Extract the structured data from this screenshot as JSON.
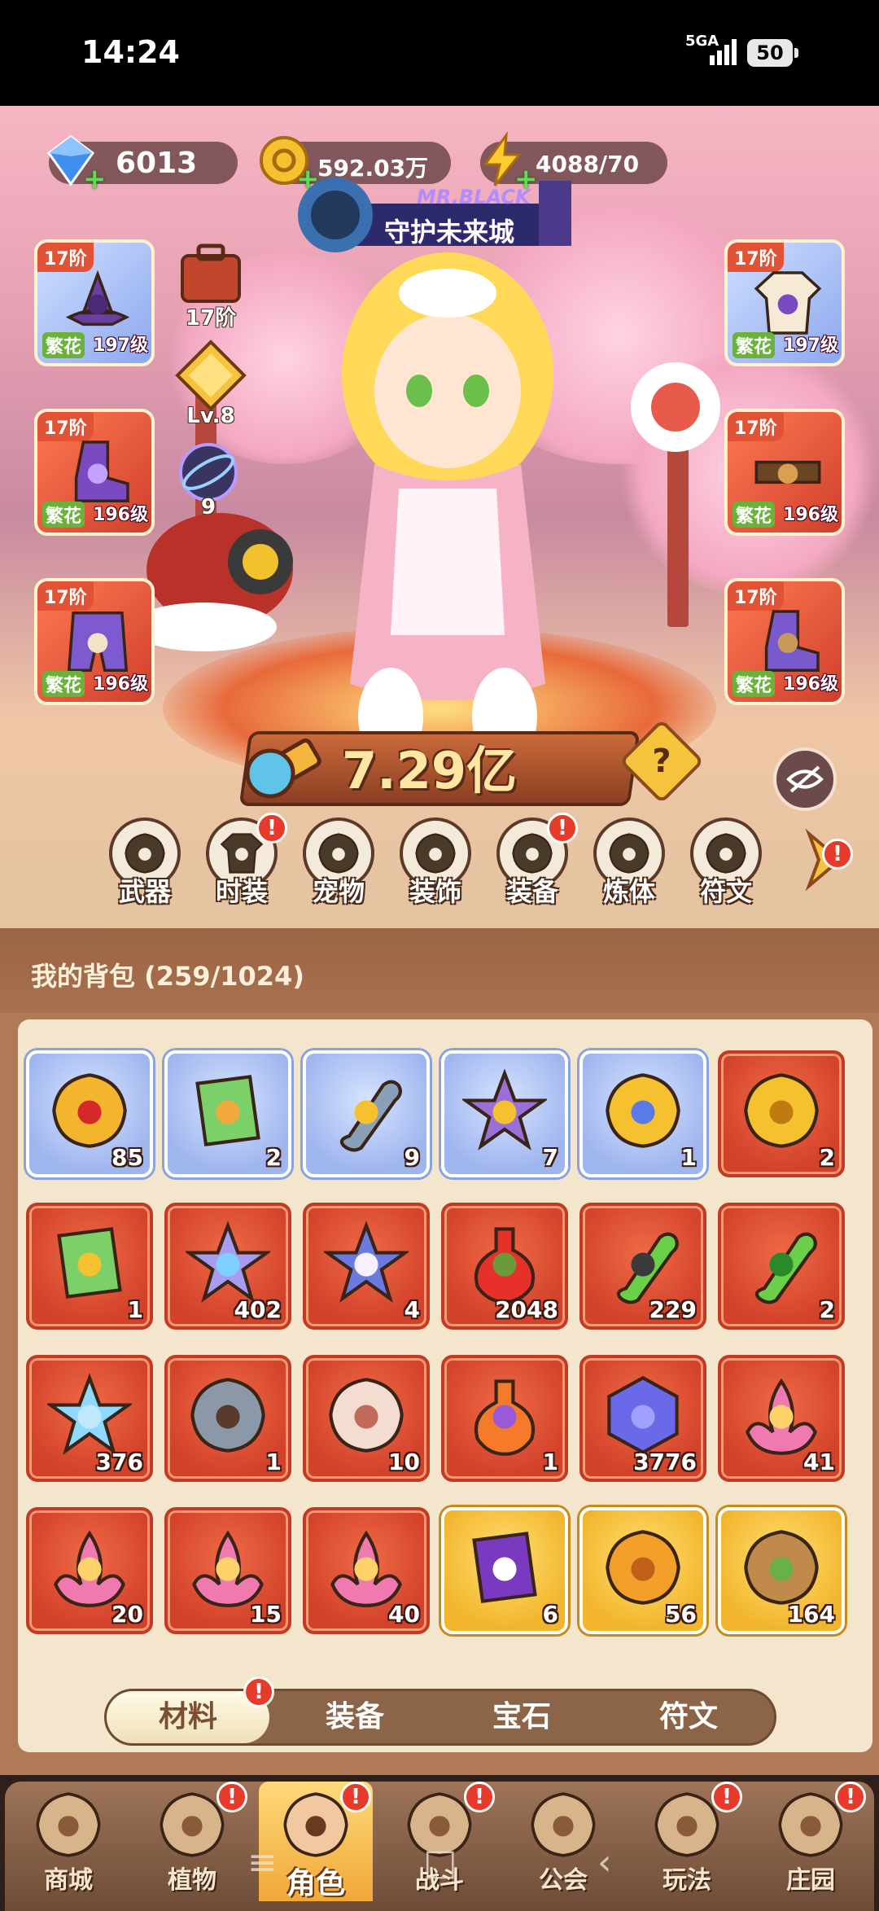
{
  "status_bar": {
    "time": "14:24",
    "network": "5GA",
    "battery": "50"
  },
  "resources": {
    "gems": "6013",
    "gold": "592.03万",
    "energy": "4088/70"
  },
  "event_banner": {
    "subtitle": "MR.BLACK",
    "label": "守护未来城"
  },
  "equipment": {
    "left": [
      {
        "tier": "17阶",
        "name": "繁花",
        "level": "197级",
        "style": "blue",
        "icon": "hat-icon"
      },
      {
        "tier": "17阶",
        "name": "繁花",
        "level": "196级",
        "style": "red",
        "icon": "glove-icon"
      },
      {
        "tier": "17阶",
        "name": "繁花",
        "level": "196级",
        "style": "red",
        "icon": "pants-icon"
      }
    ],
    "right": [
      {
        "tier": "17阶",
        "name": "繁花",
        "level": "197级",
        "style": "blue",
        "icon": "robe-icon"
      },
      {
        "tier": "17阶",
        "name": "繁花",
        "level": "196级",
        "style": "red",
        "icon": "belt-icon"
      },
      {
        "tier": "17阶",
        "name": "繁花",
        "level": "196级",
        "style": "red",
        "icon": "boots-icon"
      }
    ]
  },
  "hero_stats": {
    "bag_tier": "17阶",
    "level": "Lv.8",
    "orb_count": "9"
  },
  "combat_power": "7.29亿",
  "categories": [
    {
      "label": "武器",
      "icon": "weapon-icon",
      "alert": false
    },
    {
      "label": "时装",
      "icon": "outfit-icon",
      "alert": true
    },
    {
      "label": "宠物",
      "icon": "pet-icon",
      "alert": false
    },
    {
      "label": "装饰",
      "icon": "mask-icon",
      "alert": false
    },
    {
      "label": "装备",
      "icon": "gear-icon",
      "alert": true
    },
    {
      "label": "炼体",
      "icon": "body-training-icon",
      "alert": false
    },
    {
      "label": "符文",
      "icon": "rune-icon",
      "alert": false
    }
  ],
  "backpack": {
    "title": "我的背包 (259/1024)",
    "rows": [
      [
        {
          "count": "85",
          "style": "blue",
          "icon": "scarab-gem-icon"
        },
        {
          "count": "2",
          "style": "blue",
          "icon": "plant-card-icon"
        },
        {
          "count": "9",
          "style": "blue",
          "icon": "syringe-icon"
        },
        {
          "count": "7",
          "style": "blue",
          "icon": "star-badge-icon"
        },
        {
          "count": "1",
          "style": "blue",
          "icon": "astrolabe-icon"
        },
        {
          "count": "2",
          "style": "red",
          "icon": "seed-icon"
        }
      ],
      [
        {
          "count": "1",
          "style": "red",
          "icon": "clock-card-icon"
        },
        {
          "count": "402",
          "style": "red",
          "icon": "crystal-star-icon"
        },
        {
          "count": "4",
          "style": "red",
          "icon": "moon-star-icon"
        },
        {
          "count": "2048",
          "style": "red",
          "icon": "potion-icon"
        },
        {
          "count": "229",
          "style": "red",
          "icon": "green-tube-icon"
        },
        {
          "count": "2",
          "style": "red",
          "icon": "green-capsule-icon"
        }
      ],
      [
        {
          "count": "376",
          "style": "red",
          "icon": "hexagram-gem-icon"
        },
        {
          "count": "1",
          "style": "red",
          "icon": "tools-icon"
        },
        {
          "count": "10",
          "style": "red",
          "icon": "knot-icon"
        },
        {
          "count": "1",
          "style": "red",
          "icon": "fire-orb-icon"
        },
        {
          "count": "3776",
          "style": "red",
          "icon": "cube-cluster-icon"
        },
        {
          "count": "41",
          "style": "red",
          "icon": "flame-lotus-icon"
        }
      ],
      [
        {
          "count": "20",
          "style": "red",
          "icon": "flame-lotus-icon"
        },
        {
          "count": "15",
          "style": "red",
          "icon": "flame-lotus-icon"
        },
        {
          "count": "40",
          "style": "red",
          "icon": "flame-lotus-icon"
        },
        {
          "count": "6",
          "style": "gold",
          "icon": "skull-scroll-icon"
        },
        {
          "count": "56",
          "style": "gold",
          "icon": "cookie-icon"
        },
        {
          "count": "164",
          "style": "gold",
          "icon": "basket-icon"
        }
      ]
    ]
  },
  "bag_tabs": [
    {
      "label": "材料",
      "active": true,
      "alert": true
    },
    {
      "label": "装备",
      "active": false,
      "alert": false
    },
    {
      "label": "宝石",
      "active": false,
      "alert": false
    },
    {
      "label": "符文",
      "active": false,
      "alert": false
    }
  ],
  "bottom_nav": [
    {
      "label": "商城",
      "icon": "shop-icon",
      "alert": false,
      "active": false
    },
    {
      "label": "植物",
      "icon": "plant-icon",
      "alert": true,
      "active": false
    },
    {
      "label": "角色",
      "icon": "character-icon",
      "alert": true,
      "active": true
    },
    {
      "label": "战斗",
      "icon": "battle-icon",
      "alert": true,
      "active": false
    },
    {
      "label": "公会",
      "icon": "guild-icon",
      "alert": false,
      "active": false
    },
    {
      "label": "玩法",
      "icon": "gameplay-icon",
      "alert": true,
      "active": false
    },
    {
      "label": "庄园",
      "icon": "manor-icon",
      "alert": true,
      "active": false
    }
  ],
  "colors": {
    "accent": "#e25336",
    "alert": "#e83a2a",
    "name_tag": "#69b33b"
  }
}
